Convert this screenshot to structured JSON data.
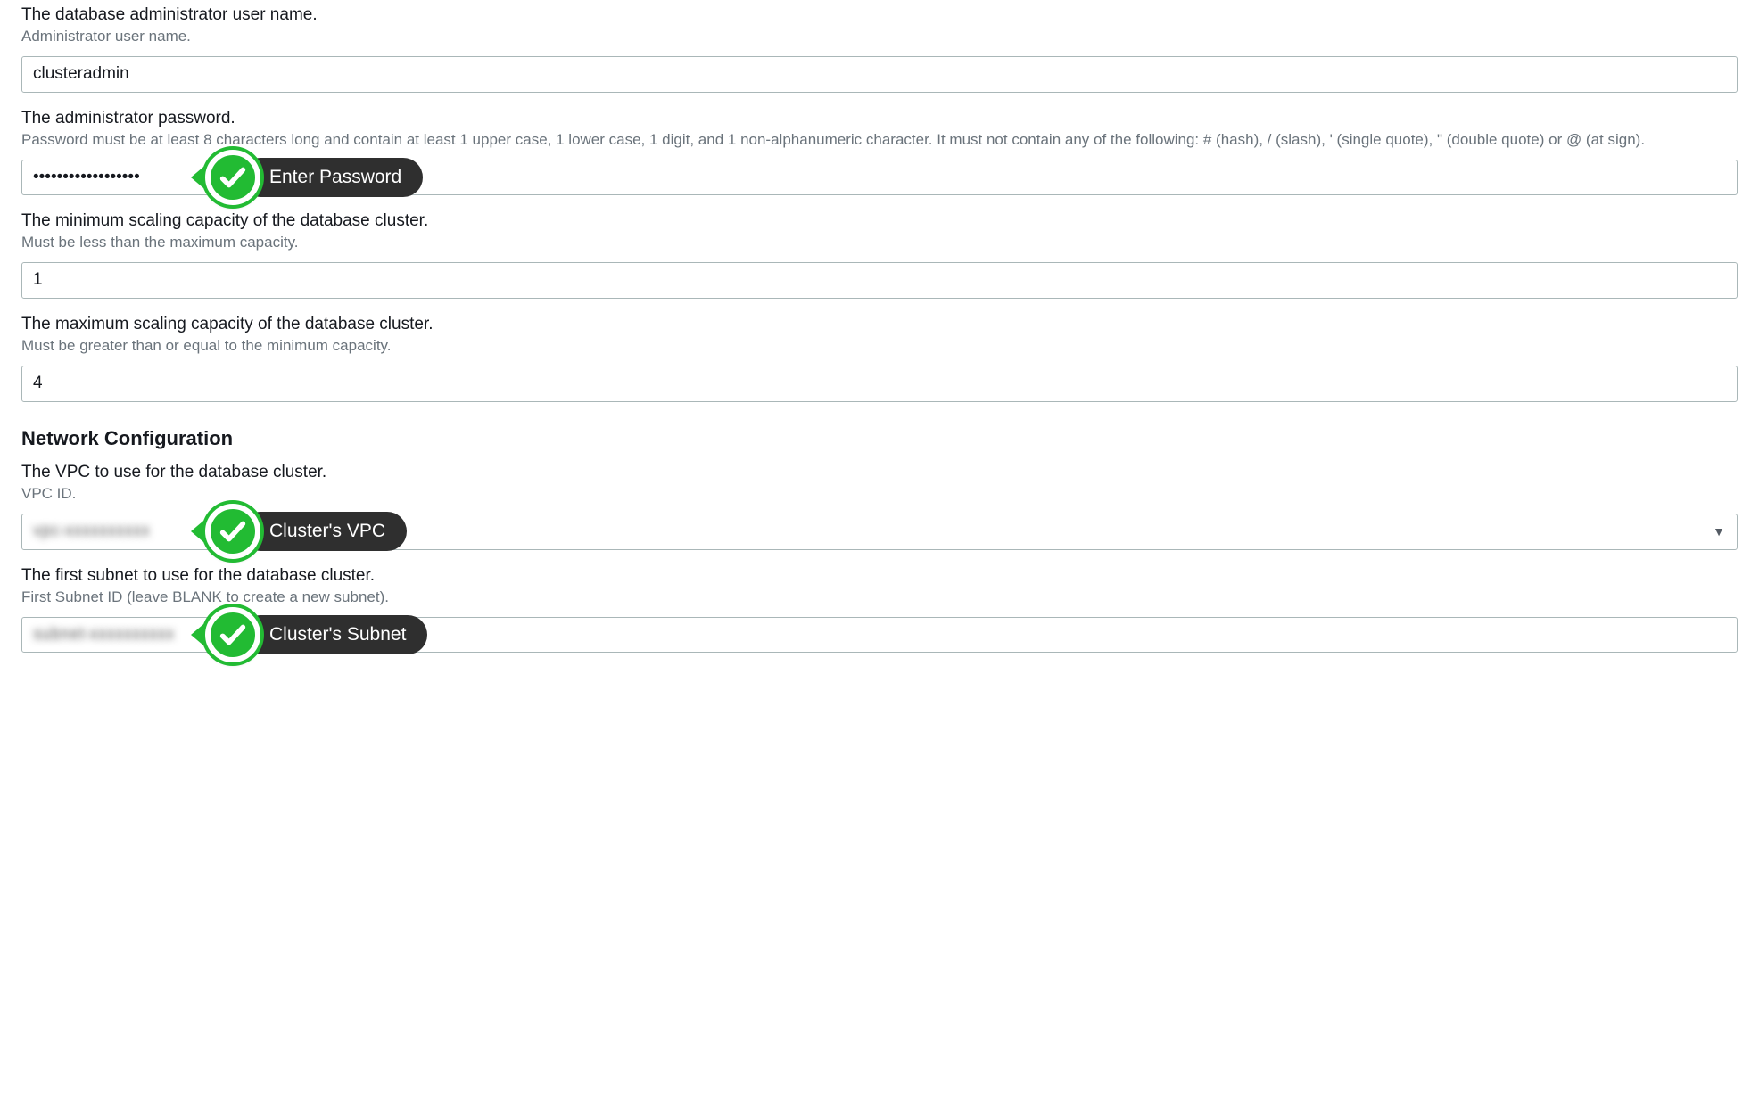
{
  "fields": {
    "admin_user": {
      "label": "The database administrator user name.",
      "hint": "Administrator user name.",
      "value": "clusteradmin"
    },
    "admin_password": {
      "label": "The administrator password.",
      "hint": "Password must be at least 8 characters long and contain at least 1 upper case, 1 lower case, 1 digit, and 1 non-alphanumeric character. It must not contain any of the following: # (hash), / (slash), ' (single quote), \" (double quote) or @ (at sign).",
      "value": "••••••••••••••••••"
    },
    "min_scaling": {
      "label": "The minimum scaling capacity of the database cluster.",
      "hint": "Must be less than the maximum capacity.",
      "value": "1"
    },
    "max_scaling": {
      "label": "The maximum scaling capacity of the database cluster.",
      "hint": "Must be greater than or equal to the minimum capacity.",
      "value": "4"
    }
  },
  "section_network": "Network Configuration",
  "network": {
    "vpc": {
      "label": "The VPC to use for the database cluster.",
      "hint": "VPC ID.",
      "value": "vpc-xxxxxxxxxx"
    },
    "subnet1": {
      "label": "The first subnet to use for the database cluster.",
      "hint": "First Subnet ID (leave BLANK to create a new subnet).",
      "value": "subnet-xxxxxxxxxx"
    }
  },
  "callouts": {
    "password": "Enter Password",
    "vpc": "Cluster's VPC",
    "subnet": "Cluster's Subnet"
  }
}
